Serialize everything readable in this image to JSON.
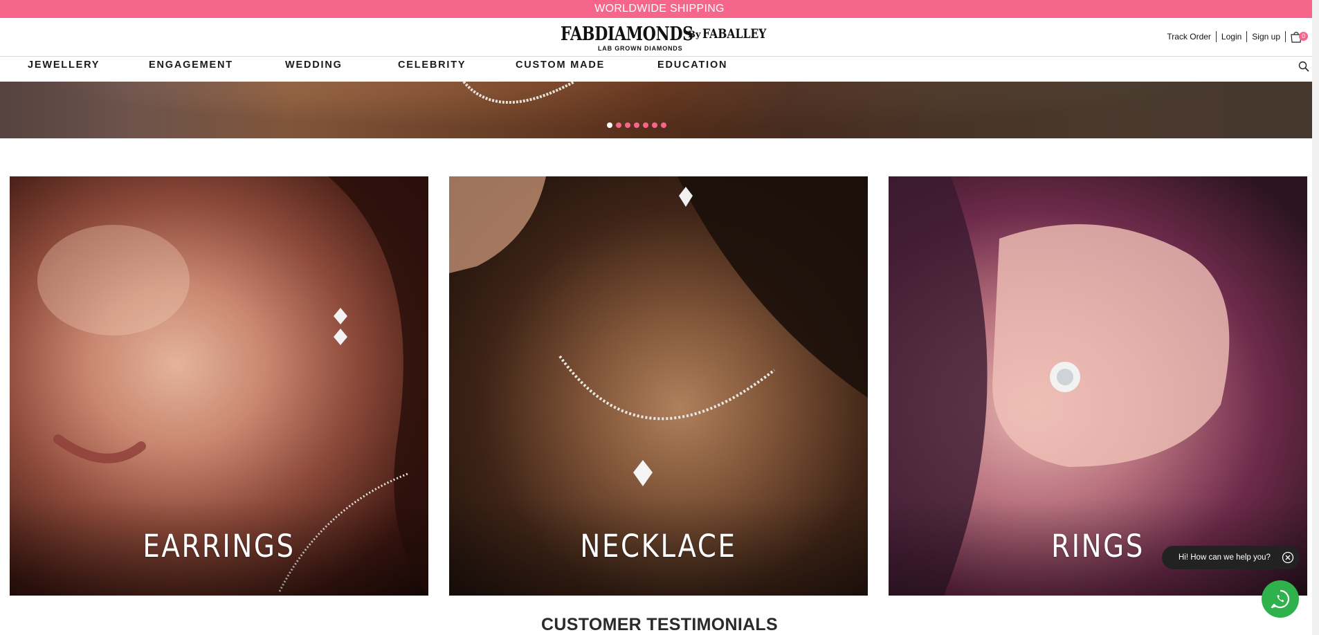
{
  "promo": {
    "text": "WORLDWIDE SHIPPING"
  },
  "brand": {
    "name": "FABDIAMONDS",
    "by": "By",
    "parent": "FABALLEY",
    "tagline": "LAB GROWN DIAMONDS"
  },
  "account": {
    "track_order": "Track Order",
    "login": "Login",
    "signup": "Sign up",
    "cart_count": "0"
  },
  "nav": {
    "items": [
      "JEWELLERY",
      "ENGAGEMENT",
      "WEDDING",
      "CELEBRITY",
      "CUSTOM MADE",
      "EDUCATION"
    ]
  },
  "hero": {
    "slide_count": 7,
    "active_slide": 1
  },
  "categories": [
    {
      "label": "EARRINGS"
    },
    {
      "label": "NECKLACE"
    },
    {
      "label": "RINGS"
    }
  ],
  "section": {
    "title": "CUSTOMER TESTIMONIALS"
  },
  "chat": {
    "prompt": "Hi! How can we help you?"
  },
  "colors": {
    "accent_pink": "#f6658a",
    "whatsapp_green": "#2fb24c"
  }
}
